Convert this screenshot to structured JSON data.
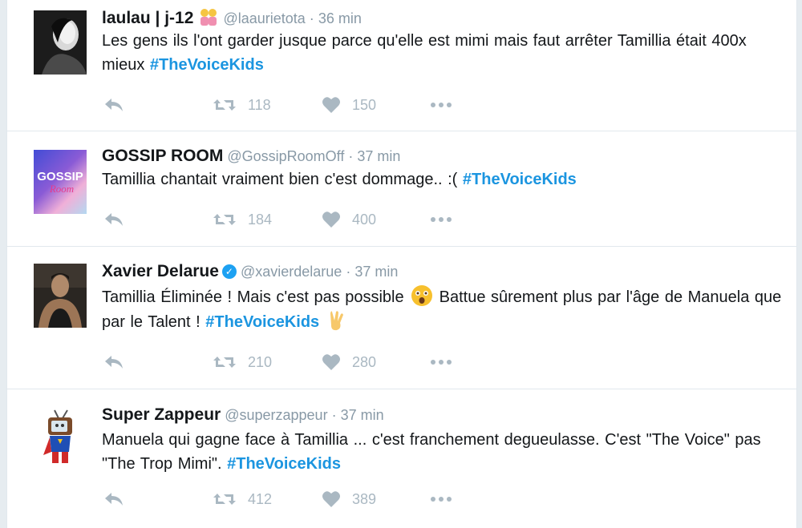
{
  "tweets": [
    {
      "name": "laulau | j-12",
      "handle": "@laaurietota",
      "time": "36 min",
      "text_before": "Les gens ils l'ont garder jusque parce qu'elle est mimi mais faut arrêter Tamillia était 400x mieux",
      "hashtag": "#TheVoiceKids",
      "retweets": "118",
      "likes": "150"
    },
    {
      "name": "GOSSIP ROOM",
      "handle": "@GossipRoomOff",
      "time": "37 min",
      "text_before": "Tamillia chantait vraiment bien c'est dommage.. :(",
      "hashtag": "#TheVoiceKids",
      "avatar_text": "GOSSIP",
      "avatar_text2": "Room",
      "retweets": "184",
      "likes": "400"
    },
    {
      "name": "Xavier Delarue",
      "handle": "@xavierdelarue",
      "time": "37 min",
      "text_part1": "Tamillia Éliminée ! Mais c'est pas possible",
      "text_part2": "Battue sûrement plus par l'âge de Manuela que par le Talent !",
      "hashtag": "#TheVoiceKids",
      "retweets": "210",
      "likes": "280"
    },
    {
      "name": "Super Zappeur",
      "handle": "@superzappeur",
      "time": "37 min",
      "text_before": "Manuela qui gagne face à Tamillia ... c'est franchement degueulasse. C'est \"The Voice\" pas \"The Trop Mimi\".",
      "hashtag": "#TheVoiceKids",
      "retweets": "412",
      "likes": "389"
    }
  ],
  "ui": {
    "separator": "·",
    "verified_mark": "✓",
    "icons": {
      "reply": "reply-icon",
      "retweet": "retweet-icon",
      "like": "heart-icon",
      "more": "more-dots-icon",
      "verified": "verified-badge-icon"
    },
    "colors": {
      "accent": "#1b95e0",
      "muted": "#aab8c2",
      "secondary_text": "#8899a6",
      "verified": "#1da1f2"
    }
  }
}
